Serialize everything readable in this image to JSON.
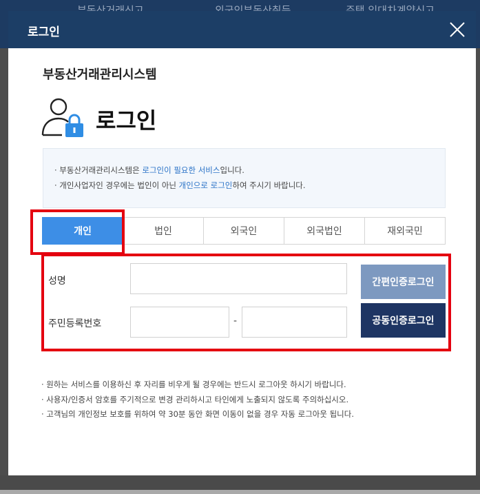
{
  "backdrop": {
    "nav": [
      "부동산거래신고",
      "외국인부동산취득",
      "주택 임대차계약신고"
    ]
  },
  "modal": {
    "title": "로그인",
    "close_icon": "close-icon"
  },
  "system_title": "부동산거래관리시스템",
  "hero": {
    "icon": "user-lock-icon",
    "title": "로그인"
  },
  "notice": {
    "line1": {
      "pre": "· 부동산거래관리시스템은 ",
      "highlight": "로그인이 필요한 서비스",
      "post": "입니다."
    },
    "line2": {
      "pre": "· 개인사업자인 경우에는 법인이 아닌 ",
      "highlight": "개인으로 로그인",
      "post": "하여 주시기 바랍니다."
    }
  },
  "tabs": [
    {
      "label": "개인",
      "active": true
    },
    {
      "label": "법인",
      "active": false
    },
    {
      "label": "외국인",
      "active": false
    },
    {
      "label": "외국법인",
      "active": false
    },
    {
      "label": "재외국민",
      "active": false
    }
  ],
  "form": {
    "name_label": "성명",
    "name_value": "",
    "rrn_label": "주민등록번호",
    "rrn_front_value": "",
    "rrn_back_value": "",
    "rrn_separator": "-",
    "simple_cert_button": "간편인증로그인",
    "joint_cert_button": "공동인증로그인"
  },
  "bottom_notes": [
    "· 원하는 서비스를 이용하신 후 자리를 비우게 될 경우에는 반드시 로그아웃 하시기 바랍니다.",
    "· 사용자/인증서 암호를 주기적으로 변경 관리하시고 타인에게 노출되지 않도록 주의하십시오.",
    "· 고객님의 개인정보 보호를 위하여 약 30분 동안 화면 이동이 없을 경우 자동 로그아웃 됩니다."
  ],
  "colors": {
    "header": "#1c3e66",
    "active_tab": "#3d8ee6",
    "simple_button": "#7d99c0",
    "joint_button": "#1e3563",
    "highlight_text": "#2b73c7",
    "annotation": "#e4000f"
  }
}
